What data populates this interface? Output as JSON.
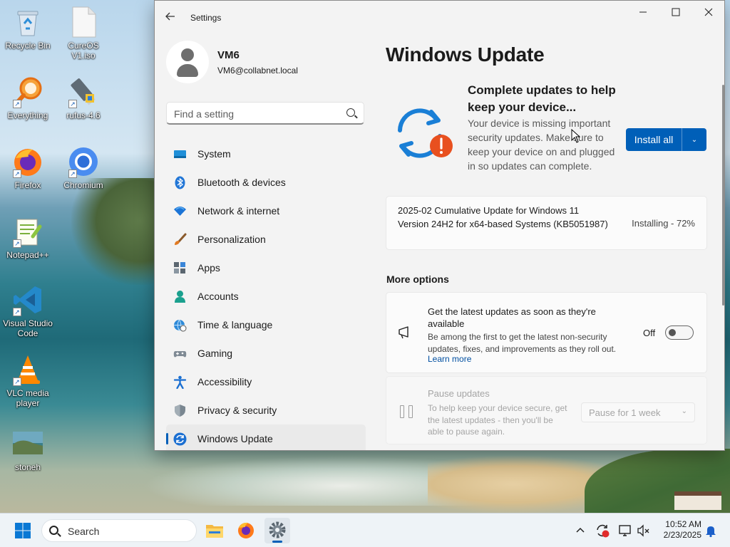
{
  "desktop": {
    "icons": [
      {
        "label": "Recycle Bin",
        "icon": "recycle-bin-icon"
      },
      {
        "label": "CureOS V1.iso",
        "icon": "iso-file-icon"
      },
      {
        "label": "Everything",
        "icon": "everything-search-icon"
      },
      {
        "label": "rufus-4.6",
        "icon": "usb-drive-icon"
      },
      {
        "label": "Firefox",
        "icon": "firefox-icon"
      },
      {
        "label": "Chromium",
        "icon": "chromium-icon"
      },
      {
        "label": "Notepad++",
        "icon": "notepad-plus-plus-icon"
      },
      {
        "label": "Visual Studio Code",
        "icon": "vscode-icon"
      },
      {
        "label": "VLC media player",
        "icon": "vlc-icon"
      },
      {
        "label": "stoneh",
        "icon": "image-file-icon"
      }
    ]
  },
  "window": {
    "title": "Settings",
    "controls": {
      "minimize": "—",
      "maximize": "☐",
      "close": "✕"
    }
  },
  "profile": {
    "name": "VM6",
    "email": "VM6@collabnet.local"
  },
  "search": {
    "placeholder": "Find a setting"
  },
  "nav": {
    "items": [
      {
        "label": "System",
        "icon": "system-icon"
      },
      {
        "label": "Bluetooth & devices",
        "icon": "bluetooth-icon"
      },
      {
        "label": "Network & internet",
        "icon": "wifi-icon"
      },
      {
        "label": "Personalization",
        "icon": "brush-icon"
      },
      {
        "label": "Apps",
        "icon": "apps-icon"
      },
      {
        "label": "Accounts",
        "icon": "accounts-icon"
      },
      {
        "label": "Time & language",
        "icon": "globe-clock-icon"
      },
      {
        "label": "Gaming",
        "icon": "gamepad-icon"
      },
      {
        "label": "Accessibility",
        "icon": "accessibility-icon"
      },
      {
        "label": "Privacy & security",
        "icon": "shield-icon"
      },
      {
        "label": "Windows Update",
        "icon": "windows-update-icon"
      }
    ],
    "selected": "Windows Update"
  },
  "main": {
    "page_title": "Windows Update",
    "hero": {
      "heading": "Complete updates to help keep your device...",
      "description": "Your device is missing important security updates. Make sure to keep your device on and plugged in so updates can complete.",
      "install_label": "Install all",
      "dropdown_glyph": "⌄"
    },
    "update": {
      "name": "2025-02 Cumulative Update for Windows 11 Version 24H2 for x64-based Systems (KB5051987)",
      "status": "Installing - 72%",
      "progress_percent": 72
    },
    "more_options_heading": "More options",
    "latest_updates": {
      "title": "Get the latest updates as soon as they're available",
      "description": "Be among the first to get the latest non-security updates, fixes, and improvements as they roll out.",
      "link": "Learn more",
      "toggle_label": "Off",
      "toggle_on": false
    },
    "pause": {
      "title": "Pause updates",
      "description": "To help keep your device secure, get the latest updates - then you'll be able to pause again.",
      "select_value": "Pause for 1 week",
      "select_glyph": "⌄"
    }
  },
  "taskbar": {
    "search_label": "Search",
    "apps": [
      "file-explorer-icon",
      "firefox-icon",
      "settings-icon"
    ],
    "time": "10:52 AM",
    "date": "2/23/2025"
  },
  "colors": {
    "accent": "#005fb8",
    "warning": "#e8501f",
    "link": "#004fa1"
  }
}
